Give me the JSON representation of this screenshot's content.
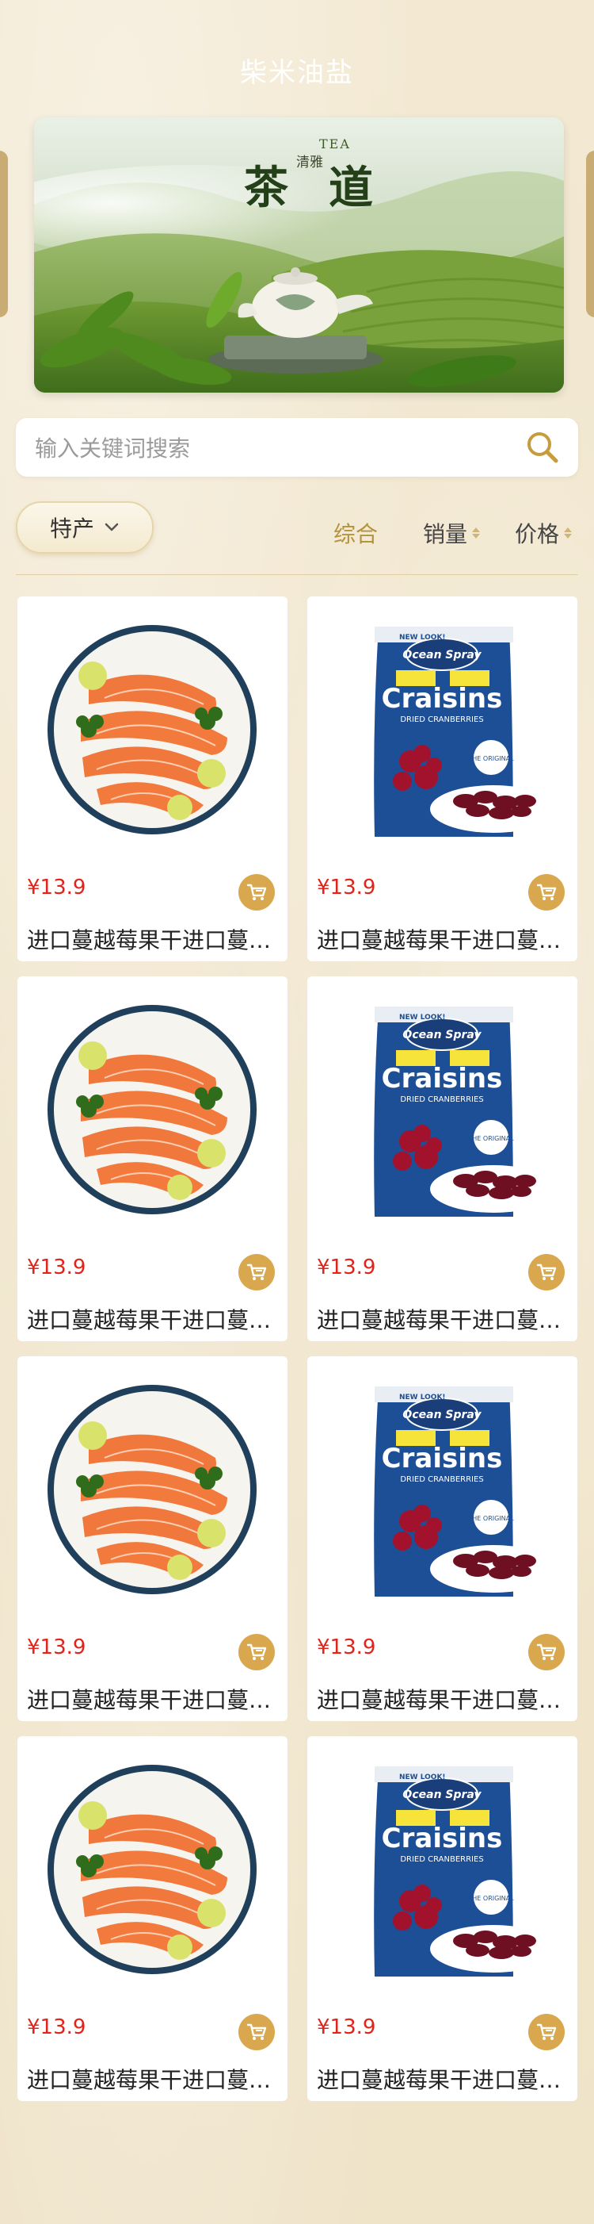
{
  "header": {
    "title": "柴米油盐"
  },
  "banner": {
    "tea_small": "TEA",
    "char1": "茶",
    "char2": "道",
    "mid_text": "清雅"
  },
  "search": {
    "placeholder": "输入关键词搜索"
  },
  "filters": {
    "category": "特产",
    "sort_comprehensive": "综合",
    "sort_sales": "销量",
    "sort_price": "价格"
  },
  "products": [
    {
      "price": "¥13.9",
      "title": "进口蔓越莓果干进口蔓越莓果干",
      "image": "salmon"
    },
    {
      "price": "¥13.9",
      "title": "进口蔓越莓果干进口蔓越莓果干",
      "image": "craisins"
    },
    {
      "price": "¥13.9",
      "title": "进口蔓越莓果干进口蔓越莓果干",
      "image": "salmon"
    },
    {
      "price": "¥13.9",
      "title": "进口蔓越莓果干进口蔓越莓果干",
      "image": "craisins"
    },
    {
      "price": "¥13.9",
      "title": "进口蔓越莓果干进口蔓越莓果干",
      "image": "salmon"
    },
    {
      "price": "¥13.9",
      "title": "进口蔓越莓果干进口蔓越莓果干",
      "image": "craisins"
    },
    {
      "price": "¥13.9",
      "title": "进口蔓越莓果干进口蔓越莓果干",
      "image": "salmon"
    },
    {
      "price": "¥13.9",
      "title": "进口蔓越莓果干进口蔓越莓果干",
      "image": "craisins"
    }
  ],
  "craisins_pack": {
    "brand": "Ocean Spray",
    "name": "Craisins",
    "sub": "DRIED CRANBERRIES",
    "badge": "NEW LOOK!",
    "original": "THE ORIGINAL"
  },
  "colors": {
    "accent": "#b4933f",
    "price": "#e2231a",
    "cart": "#d9a84e",
    "background": "#f1e7cf"
  }
}
